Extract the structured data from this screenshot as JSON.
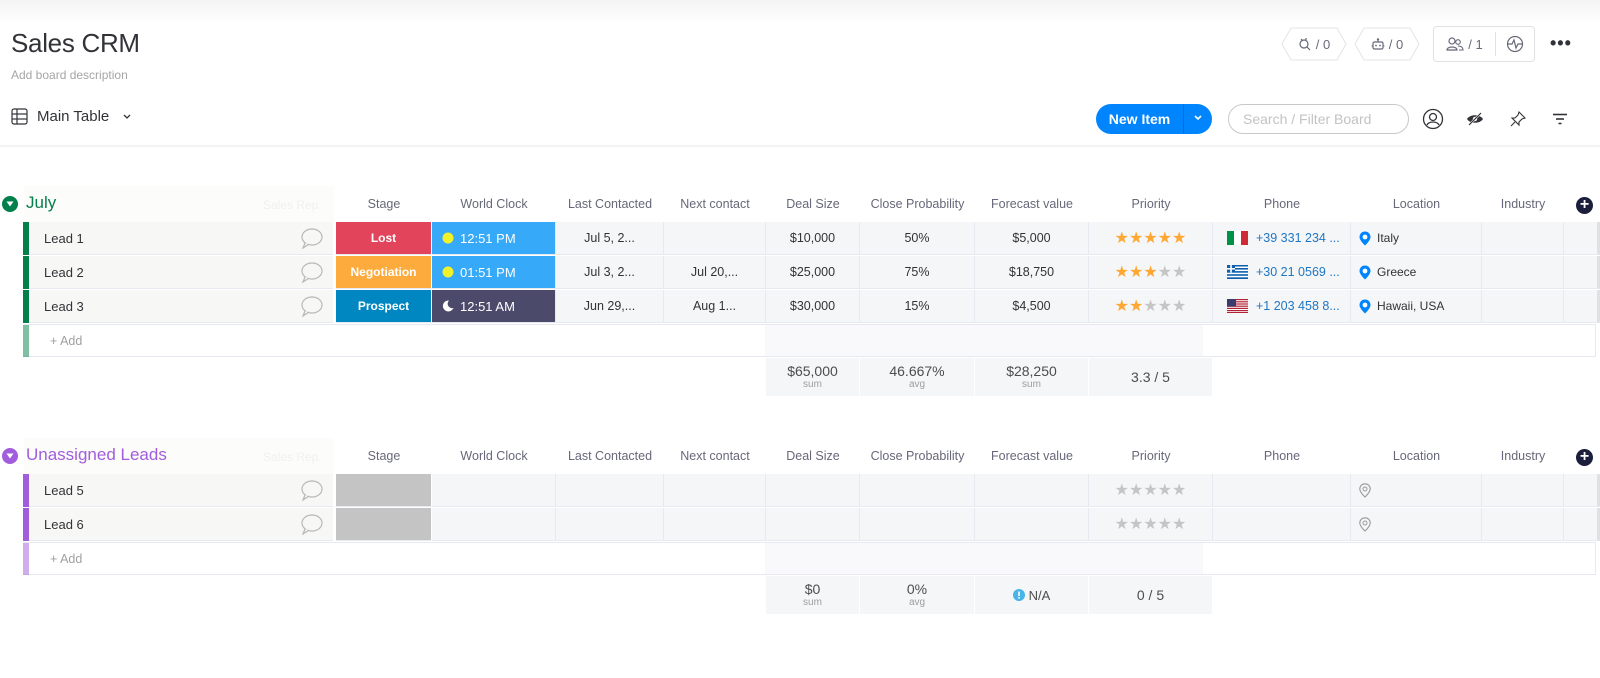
{
  "board": {
    "title": "Sales CRM",
    "description_placeholder": "Add board description"
  },
  "header": {
    "integrations_count": "/ 0",
    "automations_count": "/ 0",
    "members_count": "/ 1",
    "more_label": "•••"
  },
  "toolbar": {
    "view_label": "Main Table",
    "new_item_label": "New Item",
    "search_placeholder": "Search / Filter Board"
  },
  "columns": [
    "Sales Rep.",
    "Stage",
    "World Clock",
    "Last Contacted",
    "Next contact",
    "Deal Size",
    "Close Probability",
    "Forecast value",
    "Priority",
    "Phone",
    "Location",
    "Industry"
  ],
  "groups": [
    {
      "name": "July",
      "color": "#037f4c",
      "add_label": "+ Add",
      "rows": [
        {
          "name": "Lead 1",
          "stage": "Lost",
          "stage_color": "#e2445c",
          "clock": "12:51 PM",
          "clock_icon": "sun-icon",
          "clock_color": "#36a9f8",
          "last_contacted": "Jul 5, 2...",
          "next_contact": "",
          "deal_size": "$10,000",
          "close_probability": "50%",
          "forecast": "$5,000",
          "priority": 5,
          "phone": "+39 331 234 ...",
          "flag": "italy-flag-icon",
          "location": "Italy"
        },
        {
          "name": "Lead 2",
          "stage": "Negotiation",
          "stage_color": "#fdab3d",
          "clock": "01:51 PM",
          "clock_icon": "sun-icon",
          "clock_color": "#36a9f8",
          "last_contacted": "Jul 3, 2...",
          "next_contact": "Jul 20,...",
          "deal_size": "$25,000",
          "close_probability": "75%",
          "forecast": "$18,750",
          "priority": 3,
          "phone": "+30 21 0569 ...",
          "flag": "greece-flag-icon",
          "location": "Greece"
        },
        {
          "name": "Lead 3",
          "stage": "Prospect",
          "stage_color": "#0086c0",
          "clock": "12:51 AM",
          "clock_icon": "moon-icon",
          "clock_color": "#4c4a6b",
          "last_contacted": "Jun 29,...",
          "next_contact": "Aug 1...",
          "deal_size": "$30,000",
          "close_probability": "15%",
          "forecast": "$4,500",
          "priority": 2,
          "phone": "+1 203 458 8...",
          "flag": "usa-flag-icon",
          "location": "Hawaii, USA"
        }
      ],
      "summary": {
        "deal_size": {
          "value": "$65,000",
          "label": "sum"
        },
        "close_probability": {
          "value": "46.667%",
          "label": "avg"
        },
        "forecast": {
          "value": "$28,250",
          "label": "sum"
        },
        "priority": {
          "value": "3.3 / 5",
          "label": ""
        }
      }
    },
    {
      "name": "Unassigned Leads",
      "color": "#a25ddc",
      "add_label": "+ Add",
      "rows": [
        {
          "name": "Lead 5",
          "stage": "",
          "stage_color": "#c4c4c4",
          "clock": "",
          "clock_icon": "",
          "clock_color": "",
          "last_contacted": "",
          "next_contact": "",
          "deal_size": "",
          "close_probability": "",
          "forecast": "",
          "priority": 0,
          "phone": "",
          "flag": "",
          "location": ""
        },
        {
          "name": "Lead 6",
          "stage": "",
          "stage_color": "#c4c4c4",
          "clock": "",
          "clock_icon": "",
          "clock_color": "",
          "last_contacted": "",
          "next_contact": "",
          "deal_size": "",
          "close_probability": "",
          "forecast": "",
          "priority": 0,
          "phone": "",
          "flag": "",
          "location": ""
        }
      ],
      "summary": {
        "deal_size": {
          "value": "$0",
          "label": "sum"
        },
        "close_probability": {
          "value": "0%",
          "label": "avg"
        },
        "forecast": {
          "value": "N/A",
          "label": ""
        },
        "priority": {
          "value": "0 / 5",
          "label": ""
        }
      }
    }
  ],
  "priority_max": 5
}
